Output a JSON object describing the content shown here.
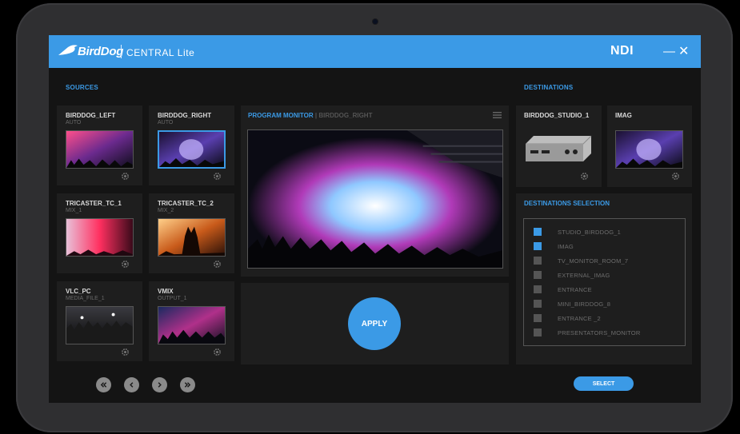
{
  "header": {
    "brand": "BirdDog",
    "product": "CENTRAL Lite",
    "ndi_logo": "NDI",
    "minimize_icon": "minimize-icon",
    "close_icon": "close-icon"
  },
  "sources": {
    "title": "SOURCES",
    "items": [
      {
        "name": "BIRDDOG_LEFT",
        "sub": "AUTO",
        "selected": false
      },
      {
        "name": "BIRDDOG_RIGHT",
        "sub": "AUTO",
        "selected": true
      },
      {
        "name": "TRICASTER_TC_1",
        "sub": "MIX_1",
        "selected": false
      },
      {
        "name": "TRICASTER_TC_2",
        "sub": "MIX_2",
        "selected": false
      },
      {
        "name": "VLC_PC",
        "sub": "MEDIA_FILE_1",
        "selected": false
      },
      {
        "name": "VMIX",
        "sub": "OUTPUT_1",
        "selected": false
      }
    ]
  },
  "program_monitor": {
    "label": "PROGRAM MONITOR",
    "source": "BIRDDOG_RIGHT"
  },
  "apply_label": "APPLY",
  "pagination": {
    "icons": [
      "first-page-icon",
      "previous-page-icon",
      "next-page-icon",
      "last-page-icon"
    ]
  },
  "destinations": {
    "title": "DESTINATIONS",
    "items": [
      {
        "name": "BIRDDOG_STUDIO_1"
      },
      {
        "name": "IMAG"
      }
    ]
  },
  "destinations_selection": {
    "title": "DESTINATIONS SELECTION",
    "items": [
      {
        "label": "STUDIO_BIRDDOG_1",
        "checked": true
      },
      {
        "label": "IMAG",
        "checked": true
      },
      {
        "label": "TV_MONITOR_ROOM_7",
        "checked": false
      },
      {
        "label": "EXTERNAL_IMAG",
        "checked": false
      },
      {
        "label": "ENTRANCE",
        "checked": false
      },
      {
        "label": "MINI_BIRDDOG_8",
        "checked": false
      },
      {
        "label": "ENTRANCE _2",
        "checked": false
      },
      {
        "label": "PRESENTATORS_MONITOR",
        "checked": false
      }
    ],
    "select_label": "SELECT"
  },
  "colors": {
    "accent": "#3b9ae6",
    "panel": "#1e1e1e",
    "background": "#141414",
    "bezel": "#2f2f31"
  }
}
